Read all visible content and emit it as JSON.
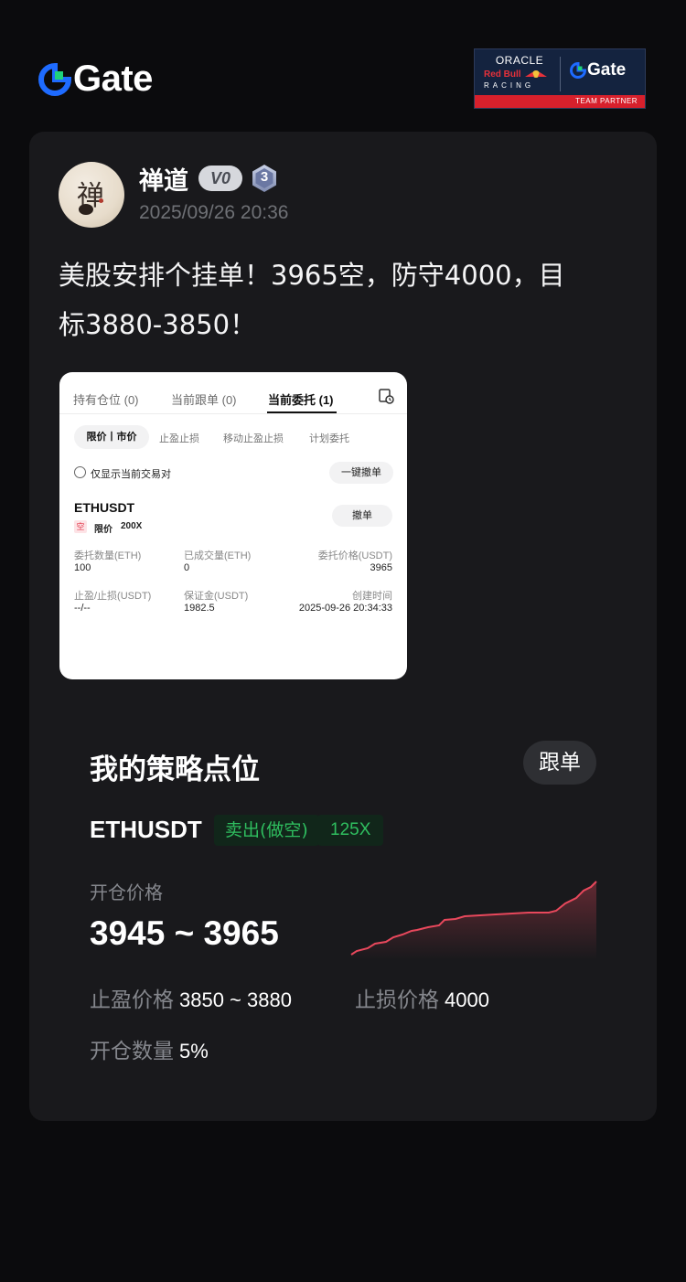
{
  "brand": {
    "name": "Gate",
    "accent": "#1e6bff"
  },
  "partner": {
    "oracle": "ORACLE",
    "redbull": "Red Bull",
    "racing": "RACING",
    "gate": "Gate",
    "band": "TEAM PARTNER"
  },
  "post": {
    "username": "禅道",
    "vip": "V0",
    "level": "3",
    "timestamp": "2025/09/26 20:36",
    "line1": "美股安排个挂单！3965空，防守4000，目",
    "line2": "标3880-3850！"
  },
  "screenshot": {
    "tabs": [
      "持有仓位 (0)",
      "当前跟单 (0)",
      "当前委托 (1)"
    ],
    "filters": [
      "限价丨市价",
      "止盈止损",
      "移动止盈止损",
      "计划委托"
    ],
    "only_current": "仅显示当前交易对",
    "cancel_all": "一键撤单",
    "pair": "ETHUSDT",
    "cancel": "撤单",
    "side": "空",
    "order_type": "限价",
    "leverage": "200X",
    "fields": {
      "qty_label": "委托数量(ETH)",
      "qty_value": "100",
      "filled_label": "已成交量(ETH)",
      "filled_value": "0",
      "price_label": "委托价格(USDT)",
      "price_value": "3965",
      "tpsl_label": "止盈/止损(USDT)",
      "tpsl_value": "--/--",
      "margin_label": "保证金(USDT)",
      "margin_value": "1982.5",
      "created_label": "创建时间",
      "created_value": "2025-09-26 20:34:33"
    }
  },
  "strategy": {
    "title": "我的策略点位",
    "follow": "跟单",
    "pair": "ETHUSDT",
    "side": "卖出(做空)",
    "leverage": "125X",
    "entry_label": "开仓价格",
    "entry_range": "3945 ~ 3965",
    "tp_label": "止盈价格",
    "tp_value": "3850 ~ 3880",
    "sl_label": "止损价格",
    "sl_value": "4000",
    "size_label": "开仓数量",
    "size_value": "5%",
    "sparkline_color": "#e8485c"
  }
}
